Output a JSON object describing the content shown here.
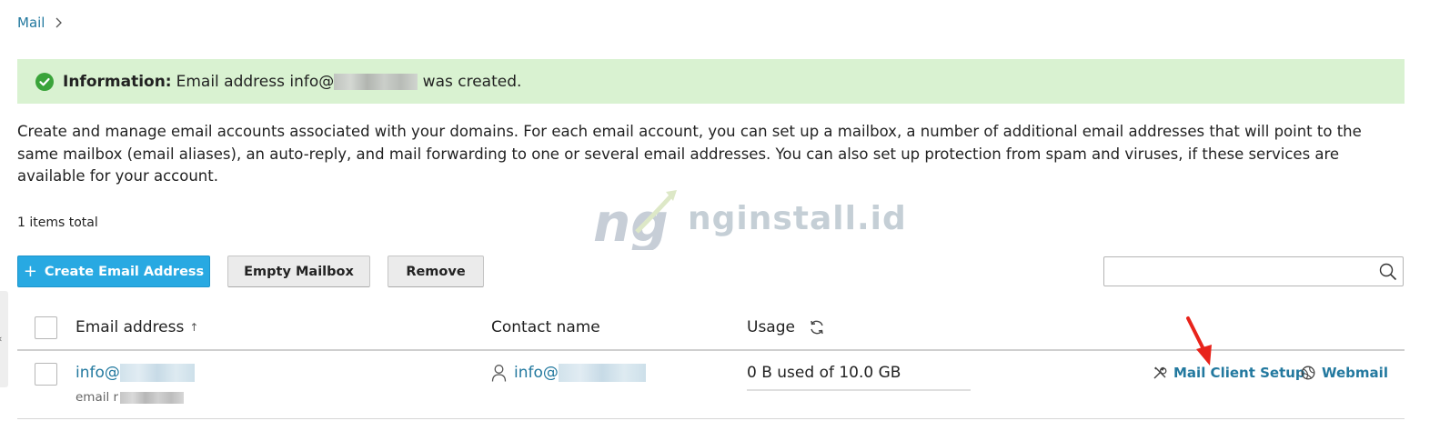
{
  "breadcrumb": {
    "mail": "Mail"
  },
  "alert": {
    "label": "Information:",
    "text_before": "Email address info@",
    "text_after": " was created."
  },
  "description": "Create and manage email accounts associated with your domains. For each email account, you can set up a mailbox, a number of additional email addresses that will point to the same mailbox (email aliases), an auto-reply, and mail forwarding to one or several email addresses. You can also set up protection from spam and viruses, if these services are available for your account.",
  "items_total": "1 items total",
  "watermark": {
    "logo_text": "ng",
    "text": "nginstall.id"
  },
  "toolbar": {
    "create_label": "Create Email Address",
    "create_icon": "+",
    "empty_label": "Empty Mailbox",
    "remove_label": "Remove"
  },
  "search": {
    "placeholder": "",
    "value": ""
  },
  "table": {
    "columns": {
      "email": "Email address",
      "email_sort": "↑",
      "contact": "Contact name",
      "usage": "Usage"
    },
    "rows": [
      {
        "email": "info@",
        "email_sub": "email r",
        "contact": "info@",
        "usage": "0 B used of 10.0 GB",
        "usage_fraction": 0.0,
        "actions": {
          "setup": "Mail Client Setup",
          "webmail": "Webmail"
        }
      }
    ]
  },
  "colors": {
    "accent": "#28a9e2",
    "link": "#23799f",
    "success_bg": "#d9f2d1",
    "success_icon": "#3aa43a",
    "annotation_arrow": "#e8231b"
  },
  "icons": {
    "breadcrumb_sep": "chevron-right-icon",
    "alert": "check-circle-icon",
    "search": "search-icon",
    "refresh": "refresh-icon",
    "contact": "user-icon",
    "setup": "tools-icon",
    "webmail": "globe-icon"
  }
}
